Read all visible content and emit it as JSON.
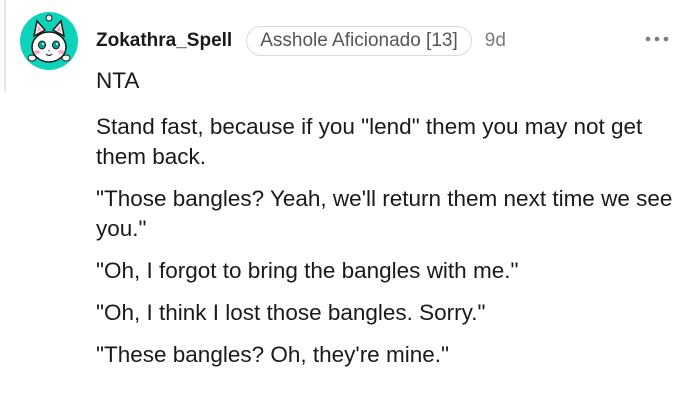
{
  "comment": {
    "author": "Zokathra_Spell",
    "flair": "Asshole Aficionado [13]",
    "age": "9d",
    "avatar_icon": "cat-avatar-icon",
    "more_icon": "more-options-icon",
    "paragraphs": [
      "NTA",
      "Stand fast, because if you \"lend\" them you may not get them back.",
      "\"Those bangles? Yeah, we'll return them next time we see you.\"",
      "\"Oh, I forgot to bring the bangles with me.\"",
      "\"Oh, I think I lost those bangles. Sorry.\"",
      "\"These bangles? Oh, they're mine.\""
    ]
  },
  "colors": {
    "avatar_bg": "#0dd3bb",
    "text": "#1a1a1b",
    "muted": "#7c7c7c",
    "flair_border": "#dadada"
  }
}
